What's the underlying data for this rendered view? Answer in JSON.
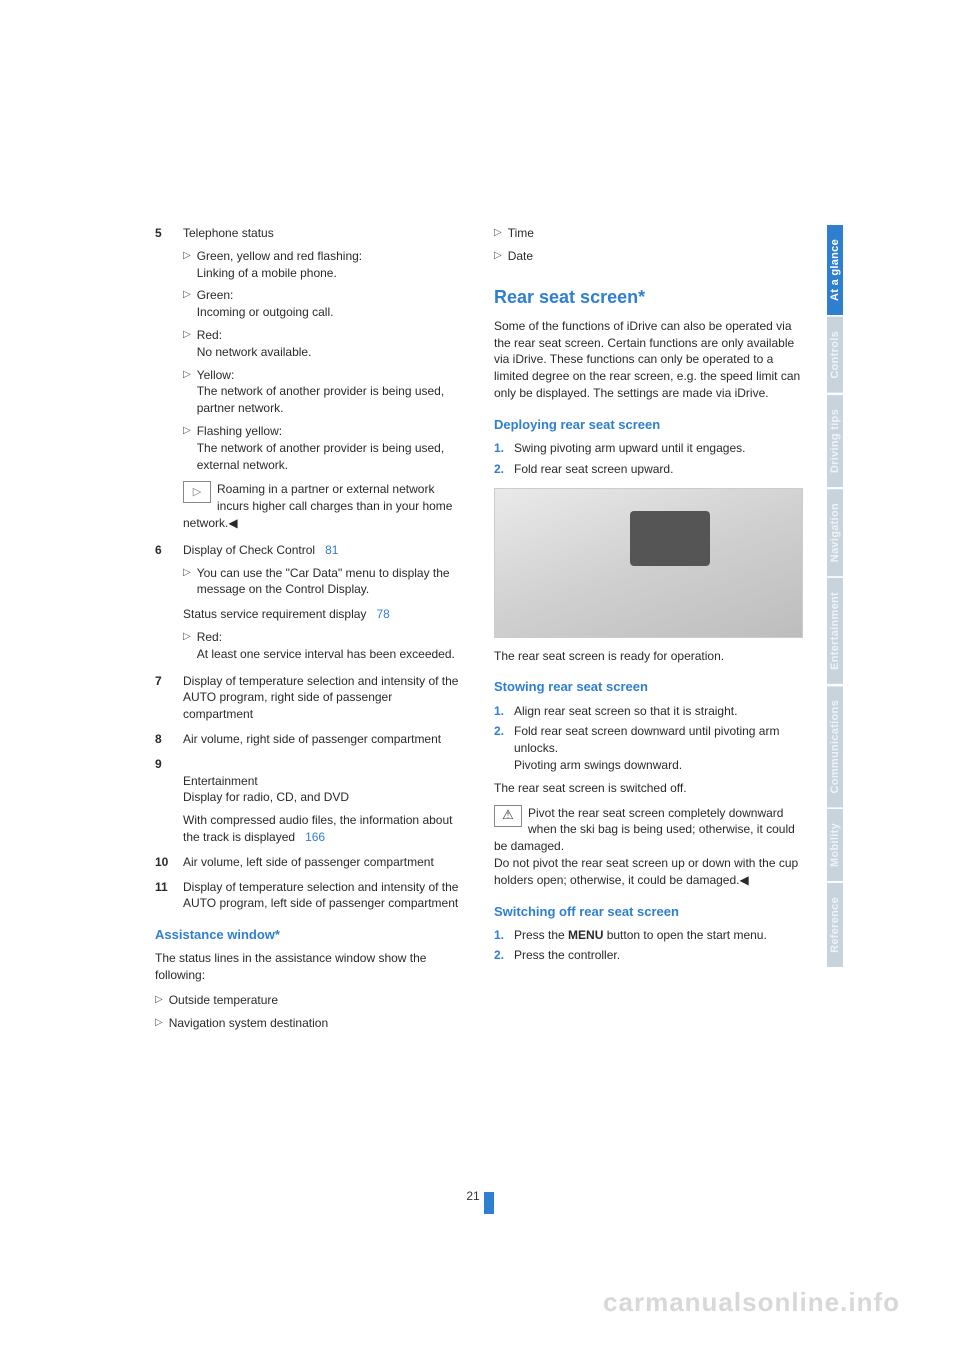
{
  "left": {
    "items": [
      {
        "num": "5",
        "text": "Telephone status",
        "subs": [
          {
            "t": "Green, yellow and red flashing:\nLinking of a mobile phone."
          },
          {
            "t": "Green:\nIncoming or outgoing call."
          },
          {
            "t": "Red:\nNo network available."
          },
          {
            "t": "Yellow:\nThe network of another provider is being used, partner network."
          },
          {
            "t": "Flashing yellow:\nThe network of another provider is being used, external network."
          }
        ],
        "note": "Roaming in a partner or external network incurs higher call charges than in your home network.◀"
      },
      {
        "num": "6",
        "text": "Display of Check Control",
        "pageref": "81",
        "subs": [
          {
            "t": "You can use the \"Car Data\" menu to display the message on the Control Display."
          }
        ],
        "tail_text": "Status service requirement display",
        "tail_ref": "78",
        "subs2": [
          {
            "t": "Red:\nAt least one service interval has been exceeded."
          }
        ]
      },
      {
        "num": "7",
        "text": "Display of temperature selection and intensity of the AUTO program, right side of passenger compartment"
      },
      {
        "num": "8",
        "text": "Air volume, right side of passenger compartment"
      },
      {
        "num": "9",
        "text": "Entertainment\nDisplay for radio, CD, and DVD",
        "tail_text": "With compressed audio files, the information about the track is displayed",
        "tail_ref": "166"
      },
      {
        "num": "10",
        "text": "Air volume, left side of passenger compartment"
      },
      {
        "num": "11",
        "text": "Display of temperature selection and intensity of the AUTO program, left side of passenger compartment"
      }
    ],
    "assist_heading": "Assistance window*",
    "assist_intro": "The status lines in the assistance window show the following:",
    "assist_items": [
      "Outside temperature",
      "Navigation system destination"
    ]
  },
  "right": {
    "top_items": [
      "Time",
      "Date"
    ],
    "h2": "Rear seat screen*",
    "intro": "Some of the functions of iDrive can also be operated via the rear seat screen. Certain functions are only available via iDrive. These functions can only be operated to a limited degree on the rear screen, e.g. the speed limit can only be displayed. The settings are made via iDrive.",
    "deploy_h": "Deploying rear seat screen",
    "deploy_steps": [
      "Swing pivoting arm upward until it engages.",
      "Fold rear seat screen upward."
    ],
    "after_img": "The rear seat screen is ready for operation.",
    "stow_h": "Stowing rear seat screen",
    "stow_steps": [
      "Align rear seat screen so that it is straight.",
      "Fold rear seat screen downward until pivoting arm unlocks.\nPivoting arm swings downward."
    ],
    "stow_after": "The rear seat screen is switched off.",
    "warn": "Pivot the rear seat screen completely downward when the ski bag is being used; otherwise, it could be damaged.\nDo not pivot the rear seat screen up or down with the cup holders open; otherwise, it could be damaged.◀",
    "switch_h": "Switching off rear seat screen",
    "switch_steps_pre": "Press the ",
    "switch_steps_bold": "MENU",
    "switch_steps_post": " button to open the start menu.",
    "switch_step2": "Press the controller."
  },
  "tabs": [
    {
      "label": "At a glance",
      "active": true
    },
    {
      "label": "Controls",
      "active": false
    },
    {
      "label": "Driving tips",
      "active": false
    },
    {
      "label": "Navigation",
      "active": false
    },
    {
      "label": "Entertainment",
      "active": false
    },
    {
      "label": "Communications",
      "active": false
    },
    {
      "label": "Mobility",
      "active": false
    },
    {
      "label": "Reference",
      "active": false
    }
  ],
  "page_number": "21",
  "watermark": "carmanualsonline.info"
}
